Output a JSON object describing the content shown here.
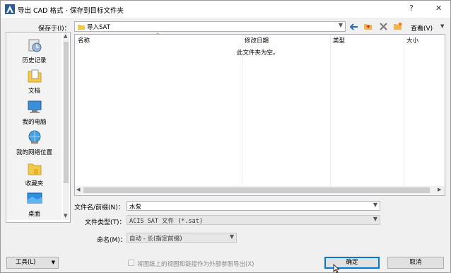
{
  "window": {
    "title": "导出 CAD 格式 - 保存到目标文件夹",
    "help": "?",
    "close": "✕"
  },
  "savein": {
    "label": "保存于(I)：",
    "value": "导入SAT"
  },
  "toolbar": {
    "view_label": "查看(V)"
  },
  "places": [
    {
      "label": "历史记录",
      "icon": "history-icon"
    },
    {
      "label": "文档",
      "icon": "documents-icon"
    },
    {
      "label": "我的电脑",
      "icon": "computer-icon"
    },
    {
      "label": "我的网络位置",
      "icon": "network-icon"
    },
    {
      "label": "收藏夹",
      "icon": "favorites-icon"
    },
    {
      "label": "桌面",
      "icon": "desktop-icon"
    }
  ],
  "filelist": {
    "columns": [
      "名称",
      "修改日期",
      "类型",
      "大小"
    ],
    "empty_text": "此文件夹为空。"
  },
  "filename": {
    "label": "文件名/前缀(N)：",
    "value": "水泵"
  },
  "filetype": {
    "label": "文件类型(T)：",
    "value": "ACIS SAT 文件 (*.sat)"
  },
  "naming": {
    "label": "命名(M)：",
    "value": "自动 - 长(指定前缀)"
  },
  "tools": {
    "label": "工具(L)"
  },
  "checkbox": {
    "label": "将图纸上的视图和链接作为外部参照导出(X)",
    "checked": false
  },
  "buttons": {
    "ok": "确定",
    "cancel": "取消"
  },
  "colors": {
    "accent": "#0078d7",
    "folder": "#f2c94c"
  }
}
